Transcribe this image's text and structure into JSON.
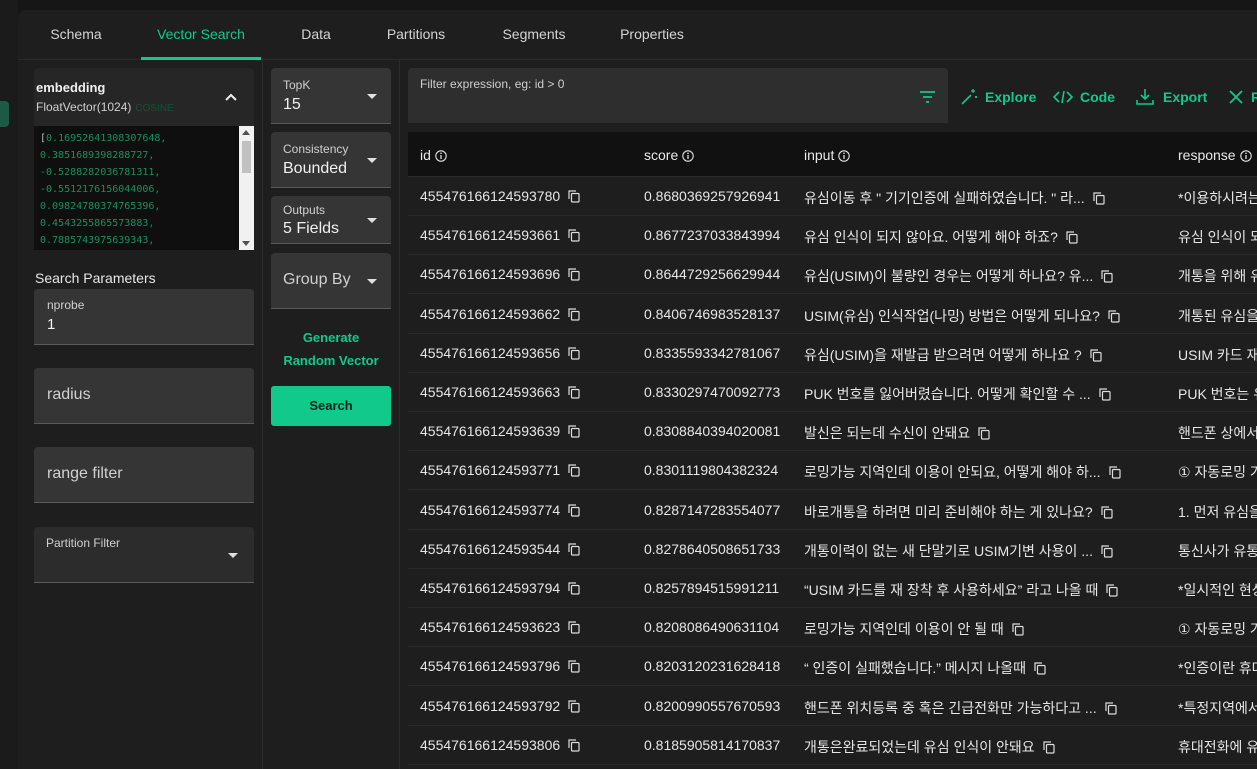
{
  "tabs": [
    {
      "label": "Schema"
    },
    {
      "label": "Vector Search"
    },
    {
      "label": "Data"
    },
    {
      "label": "Partitions"
    },
    {
      "label": "Segments"
    },
    {
      "label": "Properties"
    }
  ],
  "active_tab": "Vector Search",
  "accent_color": "#10c98a",
  "embedding": {
    "field_name": "embedding",
    "field_type": "FloatVector(1024)",
    "metric": "COSINE",
    "vector_lines": [
      "0.16952641308307648,",
      "0.3851689398288727,",
      "-0.5288282036781311,",
      "-0.5512176156044006,",
      "0.09824780374765396,",
      "0.4543255865573883,",
      "0.7885743975639343,"
    ],
    "vector_open_bracket": "["
  },
  "search_params": {
    "label": "Search Parameters",
    "nprobe_label": "nprobe",
    "nprobe_value": "1",
    "radius_placeholder": "radius",
    "range_filter_placeholder": "range filter",
    "partition_filter_label": "Partition Filter"
  },
  "options": {
    "topk_label": "TopK",
    "topk_value": "15",
    "consistency_label": "Consistency",
    "consistency_value": "Bounded",
    "outputs_label": "Outputs",
    "outputs_value": "5 Fields",
    "group_by_placeholder": "Group By",
    "generate_line1": "Generate",
    "generate_line2": "Random Vector",
    "search_label": "Search"
  },
  "filter": {
    "placeholder": "Filter expression, eg: id > 0"
  },
  "actions": {
    "explore": "Explore",
    "code": "Code",
    "export": "Export",
    "reset": "R"
  },
  "table": {
    "columns": [
      "id",
      "score",
      "input",
      "response"
    ],
    "rows": [
      {
        "id": "455476166124593780",
        "score": "0.8680369257926941",
        "input": "유심이동 후  \" 기기인증에 실패하였습니다. \" 라...",
        "response": "*이용하시려는"
      },
      {
        "id": "455476166124593661",
        "score": "0.8677237033843994",
        "input": "유심 인식이 되지 않아요. 어떻게 해야 하죠?",
        "response": "유심 인식이 되"
      },
      {
        "id": "455476166124593696",
        "score": "0.8644729256629944",
        "input": "유심(USIM)이 불량인 경우는 어떻게 하나요? 유...",
        "response": "개통을 위해 유"
      },
      {
        "id": "455476166124593662",
        "score": "0.8406746983528137",
        "input": "USIM(유심) 인식작업(나밍) 방법은 어떻게 되나요?",
        "response": "개통된 유심을"
      },
      {
        "id": "455476166124593656",
        "score": "0.8335593342781067",
        "input": "유심(USIM)을 재발급 받으려면 어떻게 하나요 ?",
        "response": "USIM 카드 재"
      },
      {
        "id": "455476166124593663",
        "score": "0.8330297470092773",
        "input": "PUK 번호를 잃어버렸습니다. 어떻게 확인할 수 ...",
        "response": "PUK 번호는 유"
      },
      {
        "id": "455476166124593639",
        "score": "0.8308840394020081",
        "input": "발신은 되는데 수신이 안돼요",
        "response": "핸드폰 상에서"
      },
      {
        "id": "455476166124593771",
        "score": "0.8301119804382324",
        "input": "로밍가능 지역인데 이용이 안되요, 어떻게 해야 하...",
        "response": "① 자동로밍 가"
      },
      {
        "id": "455476166124593774",
        "score": "0.8287147283554077",
        "input": "바로개통을 하려면 미리 준비해야 하는 게 있나요?",
        "response": "1. 먼저 유심을"
      },
      {
        "id": "455476166124593544",
        "score": "0.8278640508651733",
        "input": "개통이력이 없는 새 단말기로 USIM기변 사용이 ...",
        "response": "통신사가 유통"
      },
      {
        "id": "455476166124593794",
        "score": "0.8257894515991211",
        "input": "“USIM 카드를 재 장착 후 사용하세요” 라고 나올 때",
        "response": "*일시적인 현상"
      },
      {
        "id": "455476166124593623",
        "score": "0.8208086490631104",
        "input": "로밍가능 지역인데 이용이 안 될 때",
        "response": "① 자동로밍 가"
      },
      {
        "id": "455476166124593796",
        "score": "0.8203120231628418",
        "input": "“ 인증이 실패했습니다.” 메시지 나올때",
        "response": "*인증이란 휴대"
      },
      {
        "id": "455476166124593792",
        "score": "0.8200990557670593",
        "input": "핸드폰 위치등록 중 혹은 긴급전화만 가능하다고 ...",
        "response": "*특정지역에서"
      },
      {
        "id": "455476166124593806",
        "score": "0.8185905814170837",
        "input": "개통은완료되었는데 유심 인식이 안돼요",
        "response": "휴대전화에 유"
      }
    ]
  }
}
